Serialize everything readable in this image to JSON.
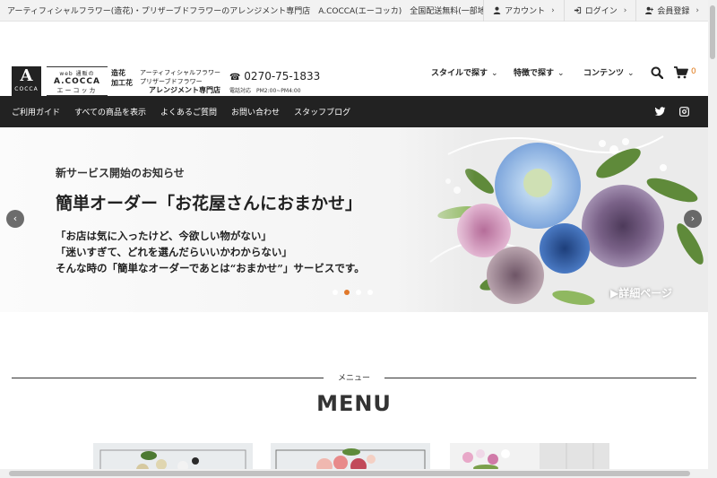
{
  "topbar": {
    "notice": "アーティフィシャルフラワー(造花)・プリザーブドフラワーのアレンジメント専門店　A.COCCA(エーコッカ)　全国配送無料(一部地域を除く)",
    "account": "アカウント",
    "login": "ログイン",
    "register": "会員登録"
  },
  "logo": {
    "mark_letter": "A",
    "mark_sub": "COCCA",
    "web_line": "web 通販の",
    "brand": "A.COCCA",
    "brand_kana": "エーコッカ",
    "cat1": "造花",
    "cat2": "加工花",
    "sub1": "アーティフィシャルフラワー",
    "sub2": "プリザーブドフラワー",
    "sub3": "アレンジメント専門店"
  },
  "contact": {
    "phone": "0270-75-1833",
    "hours": "電話対応　PM2:00~PM4:00"
  },
  "header_menu": [
    {
      "label": "スタイルで探す"
    },
    {
      "label": "特徴で探す"
    },
    {
      "label": "コンテンツ"
    }
  ],
  "cart": {
    "count": "0"
  },
  "nav": [
    {
      "label": "ご利用ガイド"
    },
    {
      "label": "すべての商品を表示"
    },
    {
      "label": "よくあるご質問"
    },
    {
      "label": "お問い合わせ"
    },
    {
      "label": "スタッフブログ"
    }
  ],
  "hero": {
    "kicker": "新サービス開始のお知らせ",
    "title": "簡単オーダー「お花屋さんにおまかせ」",
    "line1": "「お店は気に入ったけど、今欲しい物がない」",
    "line2": "「迷いすぎて、どれを選んだらいいかわからない」",
    "line3": "そんな時の「簡単なオーダーであとは“おまかせ”」サービスです。",
    "detail": "▶詳細ページ",
    "slide_count": 4,
    "active_slide": 2
  },
  "menu_section": {
    "label": "メニュー",
    "title": "MENU"
  },
  "colors": {
    "accent": "#e0782a",
    "nav_bg": "#222222"
  }
}
